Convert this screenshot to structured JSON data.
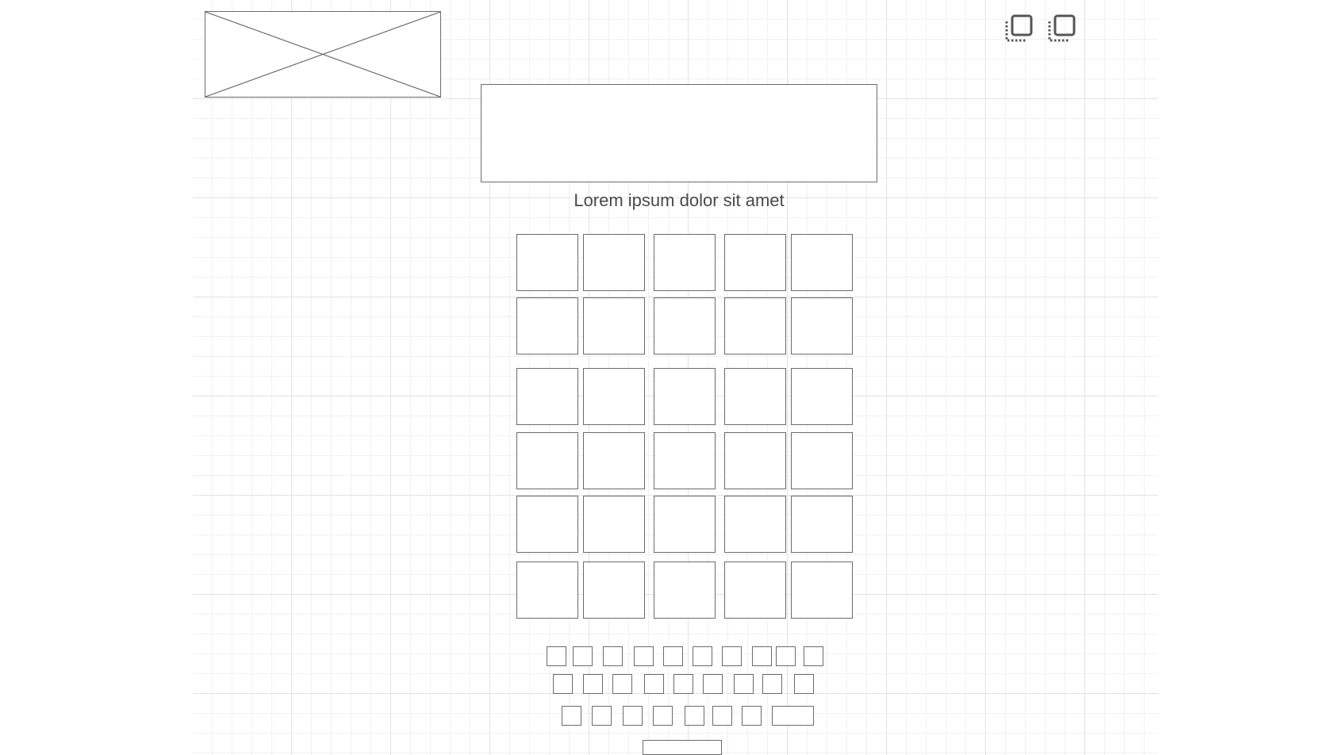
{
  "caption": {
    "text": "Lorem ipsum dolor sit amet"
  },
  "icons": [
    "layers-icon",
    "layers-icon"
  ],
  "letter_grid": {
    "rows": 6,
    "columns": 5
  },
  "keyboard": {
    "row_keys": [
      10,
      9,
      8
    ],
    "submit_key_count": 1
  }
}
